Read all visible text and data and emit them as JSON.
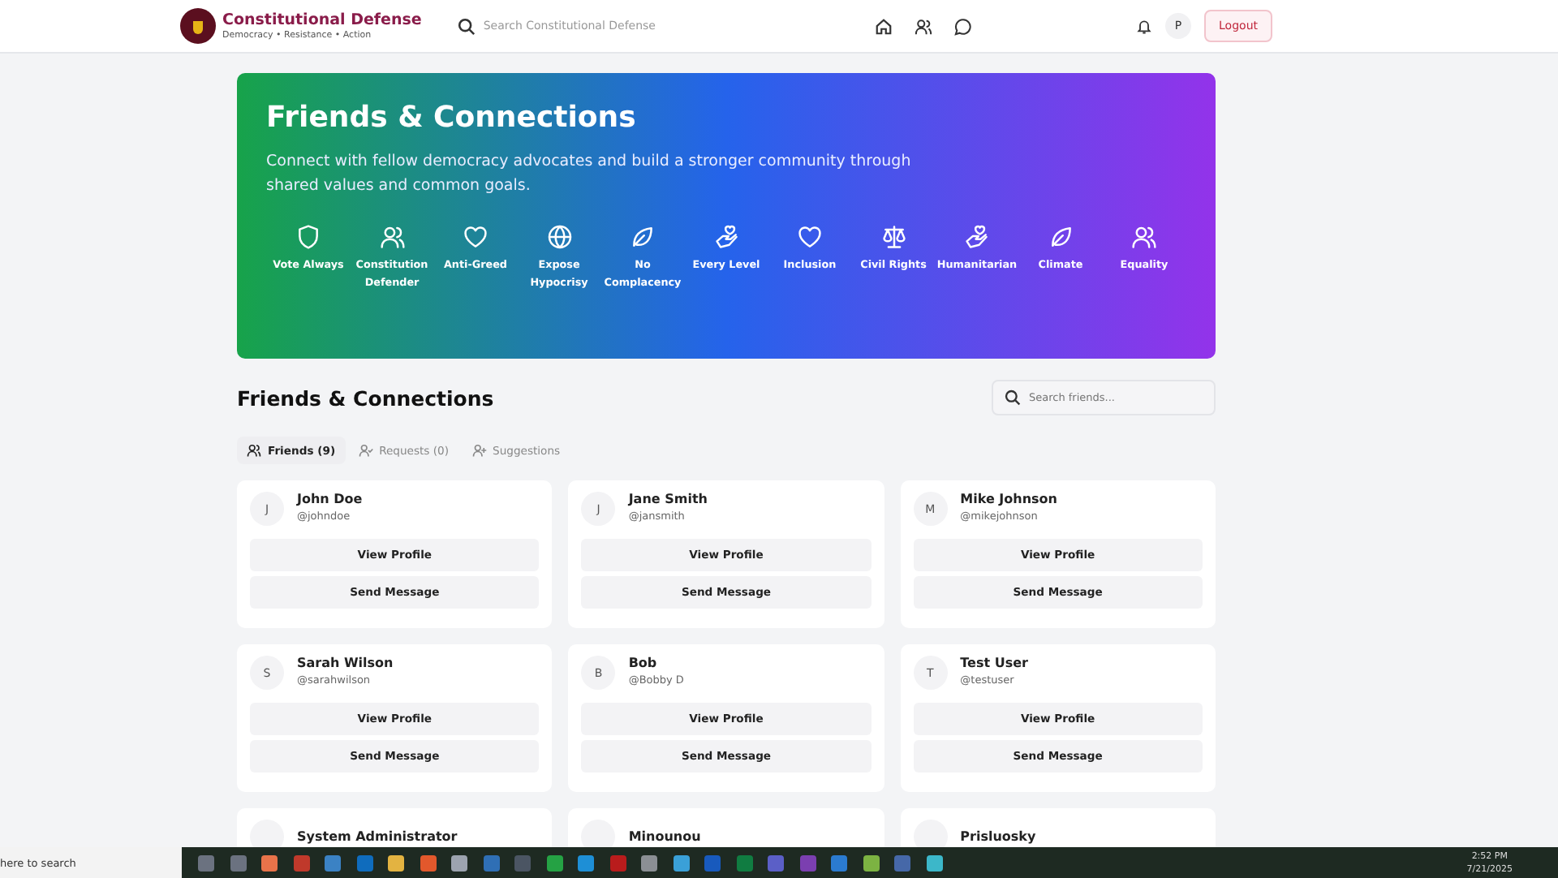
{
  "header": {
    "brand": {
      "title": "Constitutional Defense",
      "tagline": "Democracy • Resistance • Action"
    },
    "search": {
      "placeholder": "Search Constitutional Defense"
    },
    "avatar": "P",
    "logout": "Logout"
  },
  "hero": {
    "title": "Friends & Connections",
    "description": "Connect with fellow democracy advocates and build a stronger community through shared values and common goals.",
    "values": [
      {
        "kind": "shield",
        "label": "Vote Always"
      },
      {
        "kind": "users",
        "label": "Constitution Defender"
      },
      {
        "kind": "heart",
        "label": "Anti-Greed"
      },
      {
        "kind": "globe",
        "label": "Expose Hypocrisy"
      },
      {
        "kind": "leaf",
        "label": "No Complacency"
      },
      {
        "kind": "hand",
        "label": "Every Level"
      },
      {
        "kind": "heart",
        "label": "Inclusion"
      },
      {
        "kind": "scale",
        "label": "Civil Rights"
      },
      {
        "kind": "hand",
        "label": "Humanitarian"
      },
      {
        "kind": "leaf",
        "label": "Climate"
      },
      {
        "kind": "users",
        "label": "Equality"
      }
    ]
  },
  "section": {
    "title": "Friends & Connections",
    "search": {
      "placeholder": "Search friends..."
    },
    "tabs": [
      {
        "kind": "friends",
        "label": "Friends (9)",
        "selected": true
      },
      {
        "kind": "requests",
        "label": "Requests (0)",
        "selected": false
      },
      {
        "kind": "suggestions",
        "label": "Suggestions",
        "selected": false
      }
    ],
    "friends": [
      {
        "initial": "J",
        "name": "John Doe",
        "handle": "@johndoe",
        "buttons": [
          "View Profile",
          "Send Message"
        ]
      },
      {
        "initial": "J",
        "name": "Jane Smith",
        "handle": "@jansmith",
        "buttons": [
          "View Profile",
          "Send Message"
        ]
      },
      {
        "initial": "M",
        "name": "Mike Johnson",
        "handle": "@mikejohnson",
        "buttons": [
          "View Profile",
          "Send Message"
        ]
      },
      {
        "initial": "S",
        "name": "Sarah Wilson",
        "handle": "@sarahwilson",
        "buttons": [
          "View Profile",
          "Send Message"
        ]
      },
      {
        "initial": "B",
        "name": "Bob",
        "handle": "@Bobby D",
        "buttons": [
          "View Profile",
          "Send Message"
        ]
      },
      {
        "initial": "T",
        "name": "Test User",
        "handle": "@testuser",
        "buttons": [
          "View Profile",
          "Send Message"
        ]
      },
      {
        "name": "System Administrator"
      },
      {
        "name": "Minounou"
      },
      {
        "name": "Prisluosky"
      }
    ]
  },
  "taskbar": {
    "search": "here to search",
    "apps": [
      {
        "color": "#6b7280"
      },
      {
        "color": "#6b7280"
      },
      {
        "color": "#e8734a"
      },
      {
        "color": "#c0392b"
      },
      {
        "color": "#3b82c4"
      },
      {
        "color": "#0f6cbd"
      },
      {
        "color": "#e3b341"
      },
      {
        "color": "#e2582c"
      },
      {
        "color": "#9ca3af"
      },
      {
        "color": "#2f6fb5"
      },
      {
        "color": "#4b5563"
      },
      {
        "color": "#25a244"
      },
      {
        "color": "#1e8fd6"
      },
      {
        "color": "#b91c1c"
      },
      {
        "color": "#8b8f94"
      },
      {
        "color": "#3aa0d8"
      },
      {
        "color": "#185abd"
      },
      {
        "color": "#107c41"
      },
      {
        "color": "#5b5fc7"
      },
      {
        "color": "#7b3fb0"
      },
      {
        "color": "#2b7bd0"
      },
      {
        "color": "#7cb342"
      },
      {
        "color": "#4668a8"
      },
      {
        "color": "#3cb7c9"
      }
    ],
    "time": "2:52 PM",
    "date": "7/21/2025"
  }
}
